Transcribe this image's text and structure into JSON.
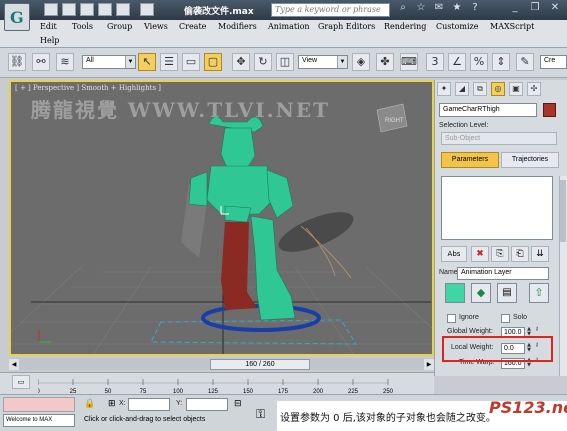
{
  "titlebar": {
    "file_title": "偷袭改文件.max",
    "search_placeholder": "Type a keyword or phrase"
  },
  "menu": {
    "items": [
      "Edit",
      "Tools",
      "Group",
      "Views",
      "Create",
      "Modifiers",
      "Animation",
      "Graph Editors",
      "Rendering",
      "Customize",
      "MAXScript",
      "Help"
    ]
  },
  "toolbar": {
    "selection_filter": "All",
    "coord_system": "View",
    "named_selection_placeholder": "Cre"
  },
  "viewport": {
    "label": "[ + ] Perspective ] Smooth + Highlights ]",
    "watermark": "腾龍視覺 WWW.TLVI.NET",
    "viewcube_label": "RIGHT"
  },
  "command_panel": {
    "object_name": "GameCharRThigh",
    "object_color": "#a8342a",
    "selection_level_label": "Selection Level:",
    "sub_object_value": "Sub-Object",
    "tab_parameters": "Parameters",
    "tab_trajectories": "Trajectories",
    "add_button_label": "Abs",
    "name_label": "Name:",
    "layer_name": "Animation Layer",
    "layer_swatch_color": "#3fd6a4",
    "ignore_label": "Ignore",
    "solo_label": "Solo",
    "global_weight_label": "Global Weight:",
    "global_weight_value": "100.0",
    "local_weight_label": "Local Weight:",
    "local_weight_value": "0.0",
    "time_warp_label": "Time Warp:",
    "time_warp_value": "160.0"
  },
  "timeline": {
    "frame_display": "160 / 260",
    "ticks": [
      "0",
      "25",
      "50",
      "75",
      "100",
      "125",
      "150",
      "175",
      "200",
      "225",
      "250"
    ]
  },
  "status": {
    "listener_text": "Welcome to MAX",
    "x_label": "X:",
    "y_label": "Y:",
    "prompt": "Click or click-and-drag to select objects"
  },
  "caption": {
    "text": "设置参数为 0 后,该对象的子对象也会随之改变。",
    "logo": "PS123.net"
  }
}
